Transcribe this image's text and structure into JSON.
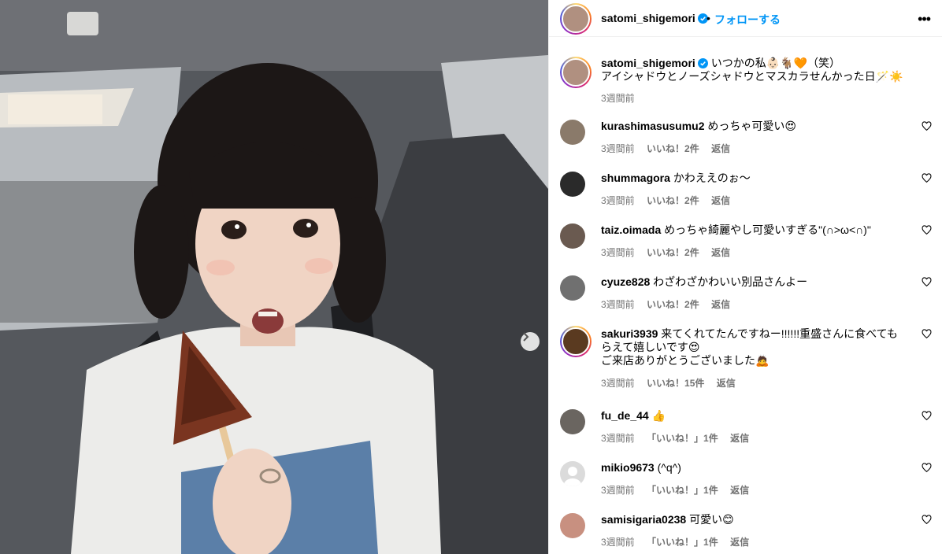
{
  "post": {
    "username": "satomi_shigemori",
    "separator": "•",
    "follow_label": "フォローする",
    "more_label": "•••",
    "caption_line1": "いつかの私👶🏻🐐🧡（笑）",
    "caption_line2": "アイシャドウとノーズシャドウとマスカラせんかった日🪄☀️",
    "caption_time": "3週間前",
    "next_label": "›"
  },
  "comments": [
    {
      "username": "kurashimasusumu2",
      "text": "めっちゃ可愛い😍",
      "time": "3週間前",
      "likes": "いいね！2件",
      "reply": "返信",
      "avatar_color": "#8a7a6a"
    },
    {
      "username": "shummagora",
      "text": "かわええのぉ〜",
      "time": "3週間前",
      "likes": "いいね！2件",
      "reply": "返信",
      "avatar_color": "#2a2a2a"
    },
    {
      "username": "taiz.oimada",
      "text": "めっちゃ綺麗やし可愛いすぎる\"(∩>ω<∩)\"",
      "time": "3週間前",
      "likes": "いいね！2件",
      "reply": "返信",
      "avatar_color": "#6a5a50"
    },
    {
      "username": "cyuze828",
      "text": "わざわざかわいい別品さんよー",
      "time": "3週間前",
      "likes": "いいね！2件",
      "reply": "返信",
      "avatar_color": "#707070"
    },
    {
      "username": "sakuri3939",
      "text": "来てくれてたんですねー!!!!!!重盛さんに食べてもらえて嬉しいです😍",
      "text2": "ご来店ありがとうございました🙇",
      "time": "3週間前",
      "likes": "いいね！15件",
      "reply": "返信",
      "avatar_color": "#5a3a20"
    },
    {
      "username": "fu_de_44",
      "text": "👍",
      "time": "3週間前",
      "likes": "「いいね！」1件",
      "reply": "返信",
      "avatar_color": "#6a6560"
    },
    {
      "username": "mikio9673",
      "text": "(^q^)",
      "time": "3週間前",
      "likes": "「いいね！」1件",
      "reply": "返信",
      "avatar_color": "#dbdbdb"
    },
    {
      "username": "samisigaria0238",
      "text": "可愛い😊",
      "time": "3週間前",
      "likes": "「いいね！」1件",
      "reply": "返信",
      "avatar_color": "#c89080"
    }
  ],
  "colors": {
    "accent": "#0095f6",
    "secondary_text": "#737373",
    "border": "#efefef"
  }
}
